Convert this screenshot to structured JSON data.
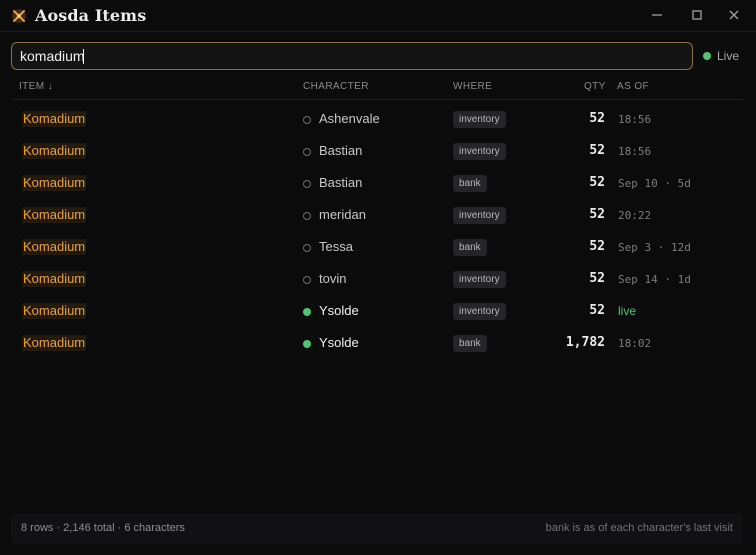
{
  "app": {
    "title": "Aosda Items"
  },
  "search": {
    "value": "komadium",
    "placeholder": "",
    "status": "Live"
  },
  "columns": {
    "item": "ITEM ↓",
    "character": "CHARACTER",
    "where": "WHERE",
    "qty": "QTY",
    "as_of": "AS OF"
  },
  "rows": [
    {
      "item": "Komadium",
      "character": "Ashenvale",
      "online": false,
      "where": "inventory",
      "qty": "52",
      "as_of": "18:56"
    },
    {
      "item": "Komadium",
      "character": "Bastian",
      "online": false,
      "where": "inventory",
      "qty": "52",
      "as_of": "18:56"
    },
    {
      "item": "Komadium",
      "character": "Bastian",
      "online": false,
      "where": "bank",
      "qty": "52",
      "as_of": "Sep 10 · 5d"
    },
    {
      "item": "Komadium",
      "character": "meridan",
      "online": false,
      "where": "inventory",
      "qty": "52",
      "as_of": "20:22"
    },
    {
      "item": "Komadium",
      "character": "Tessa",
      "online": false,
      "where": "bank",
      "qty": "52",
      "as_of": "Sep 3 · 12d"
    },
    {
      "item": "Komadium",
      "character": "tovin",
      "online": false,
      "where": "inventory",
      "qty": "52",
      "as_of": "Sep 14 · 1d"
    },
    {
      "item": "Komadium",
      "character": "Ysolde",
      "online": true,
      "where": "inventory",
      "qty": "52",
      "as_of": "live"
    },
    {
      "item": "Komadium",
      "character": "Ysolde",
      "online": true,
      "where": "bank",
      "qty": "1,782",
      "as_of": "18:02"
    }
  ],
  "footer": {
    "summary": "8 rows · 2,146 total · 6 characters",
    "note": "bank is as of each character's last visit"
  },
  "colors": {
    "accent": "#e9a043",
    "online": "#4fc47c",
    "background": "#0b0b0c"
  },
  "icons": {
    "app": "crossed-swords-icon",
    "minimize": "minimize-icon",
    "maximize": "maximize-icon",
    "close": "close-icon"
  }
}
